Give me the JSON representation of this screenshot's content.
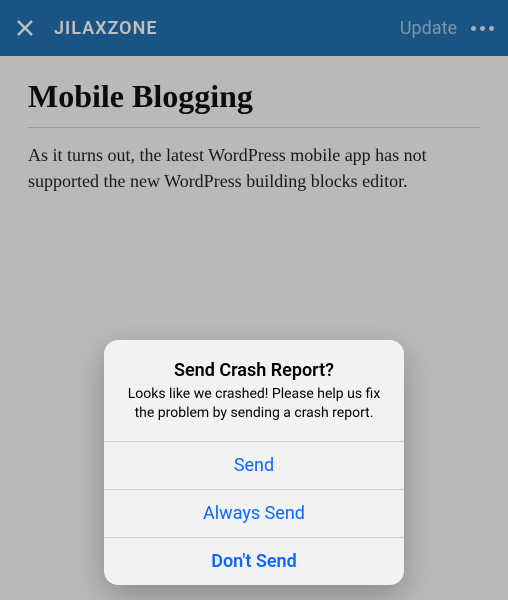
{
  "nav": {
    "title": "JILAXZONE",
    "update_label": "Update"
  },
  "post": {
    "title": "Mobile Blogging",
    "body": "As it turns out, the latest WordPress mobile app has not supported the new WordPress building blocks editor."
  },
  "alert": {
    "title": "Send Crash Report?",
    "message": "Looks like we crashed! Please help us fix the problem by sending a crash report.",
    "send_label": "Send",
    "always_send_label": "Always Send",
    "dont_send_label": "Don't Send"
  }
}
